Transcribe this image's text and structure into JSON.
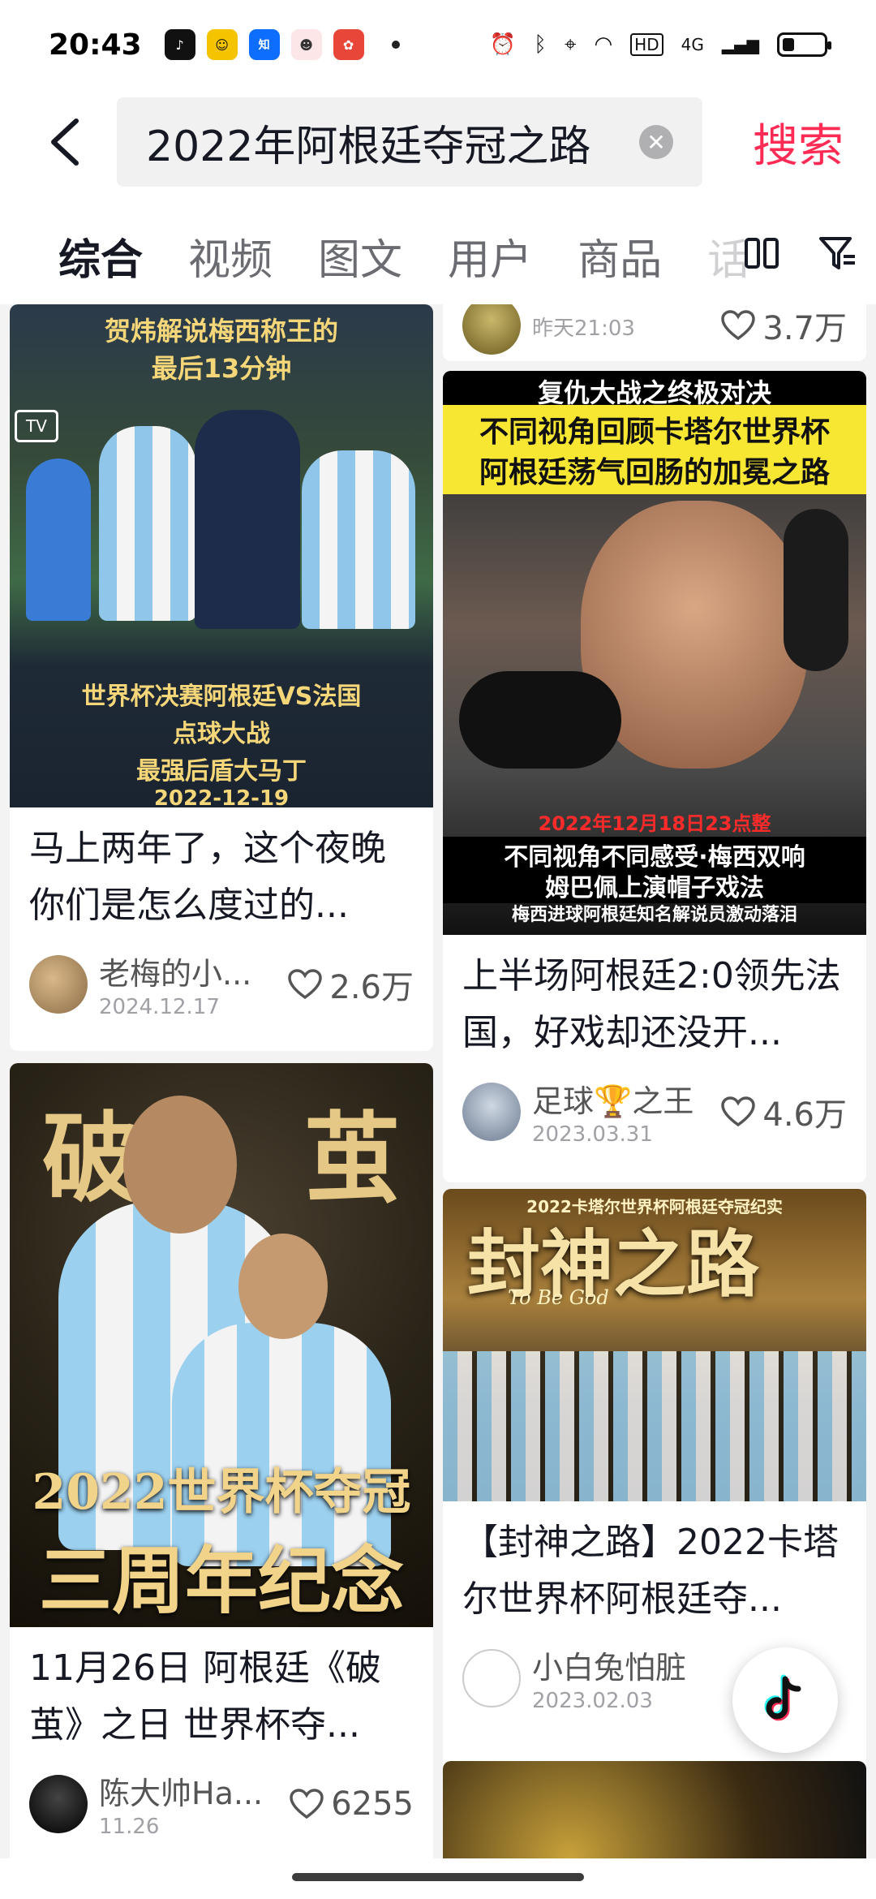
{
  "status_bar": {
    "time": "20:43",
    "signal_label": "4G",
    "hd_label": "HD"
  },
  "search": {
    "query": "2022年阿根廷夺冠之路",
    "button_label": "搜索"
  },
  "tabs": [
    {
      "label": "综合",
      "active": true
    },
    {
      "label": "视频"
    },
    {
      "label": "图文"
    },
    {
      "label": "用户"
    },
    {
      "label": "商品"
    },
    {
      "label": "话"
    }
  ],
  "cards": {
    "left1": {
      "thumb_top": "贺炜解说梅西称王的",
      "thumb_top2": "最后13分钟",
      "thumb_bottom1": "世界杯决赛阿根廷VS法国",
      "thumb_bottom2": "点球大战",
      "thumb_bottom3": "最强后盾大马丁",
      "thumb_date": "2022-12-19",
      "title": "马上两年了，这个夜晚你们是怎么度过的...",
      "author": "老梅的小...",
      "date": "2024.12.17",
      "likes": "2.6万"
    },
    "left2": {
      "thumb_big1": "破",
      "thumb_big2": "茧",
      "thumb_line1": "2022世界杯夺冠",
      "thumb_line2": "三周年纪念",
      "title": "11月26日 阿根廷《破茧》之日 世界杯夺...",
      "author": "陈大帅Ha...",
      "date": "11.26",
      "likes": "6255"
    },
    "right0": {
      "date": "昨天21:03",
      "likes": "3.7万"
    },
    "right1": {
      "thumb_head": "复仇大战之终极对决",
      "thumb_line1": "不同视角回顾卡塔尔世界杯",
      "thumb_line2": "阿根廷荡气回肠的加冕之路",
      "thumb_stamp": "2022年12月18日23点整",
      "thumb_line3": "不同视角不同感受·梅西双响",
      "thumb_line4": "姆巴佩上演帽子戏法",
      "thumb_line5": "梅西进球阿根廷知名解说员激动落泪",
      "title": "上半场阿根廷2:0领先法国，好戏却还没开...",
      "author": "足球🏆之王",
      "date": "2023.03.31",
      "likes": "4.6万"
    },
    "right2": {
      "thumb_title": "封神之路",
      "thumb_sub": "To Be God",
      "thumb_banner": "2022卡塔尔世界杯阿根廷夺冠纪实",
      "title": "【封神之路】2022卡塔尔世界杯阿根廷夺...",
      "author": "小白兔怕脏",
      "date": "2023.02.03"
    }
  },
  "colors": {
    "accent": "#fe2c55",
    "text": "#161823",
    "muted": "#a0a0a5"
  }
}
